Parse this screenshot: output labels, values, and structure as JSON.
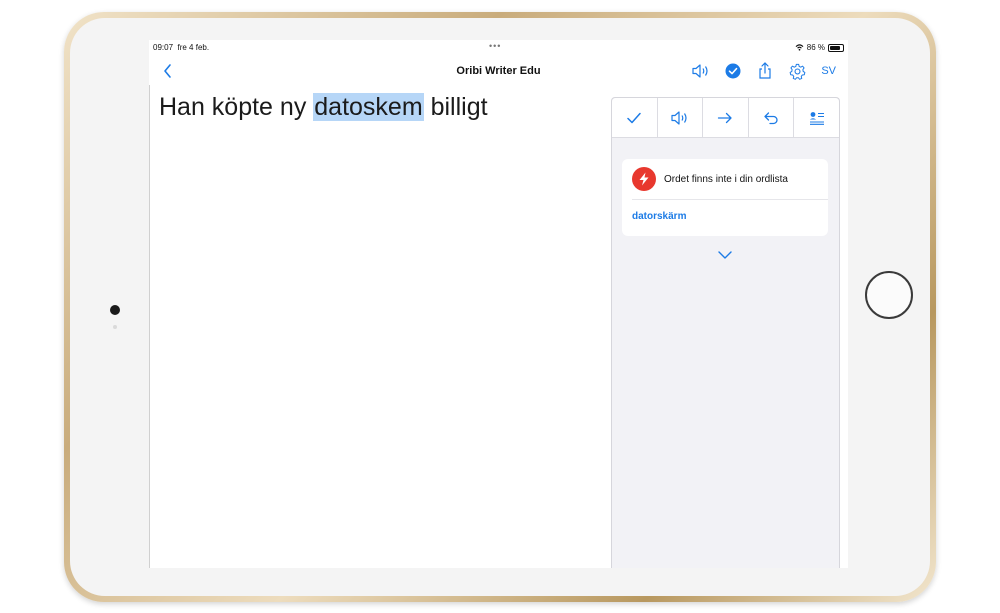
{
  "status_bar": {
    "time": "09:07",
    "date": "fre 4 feb.",
    "battery": "86 %",
    "battery_level": 0.86
  },
  "navbar": {
    "title": "Oribi Writer Edu",
    "language": "SV"
  },
  "editor": {
    "before": "Han köpte ny ",
    "highlighted": "datoskem",
    "after": " billigt"
  },
  "panel": {
    "tools": [
      "check-icon",
      "speaker-icon",
      "arrow-right-icon",
      "undo-icon",
      "list-settings-icon"
    ],
    "message": "Ordet finns inte i din ordlista",
    "suggestion": "datorskärm"
  },
  "colors": {
    "accent": "#1c7be6",
    "error": "#e8382e",
    "highlight": "#b6d6f7"
  }
}
